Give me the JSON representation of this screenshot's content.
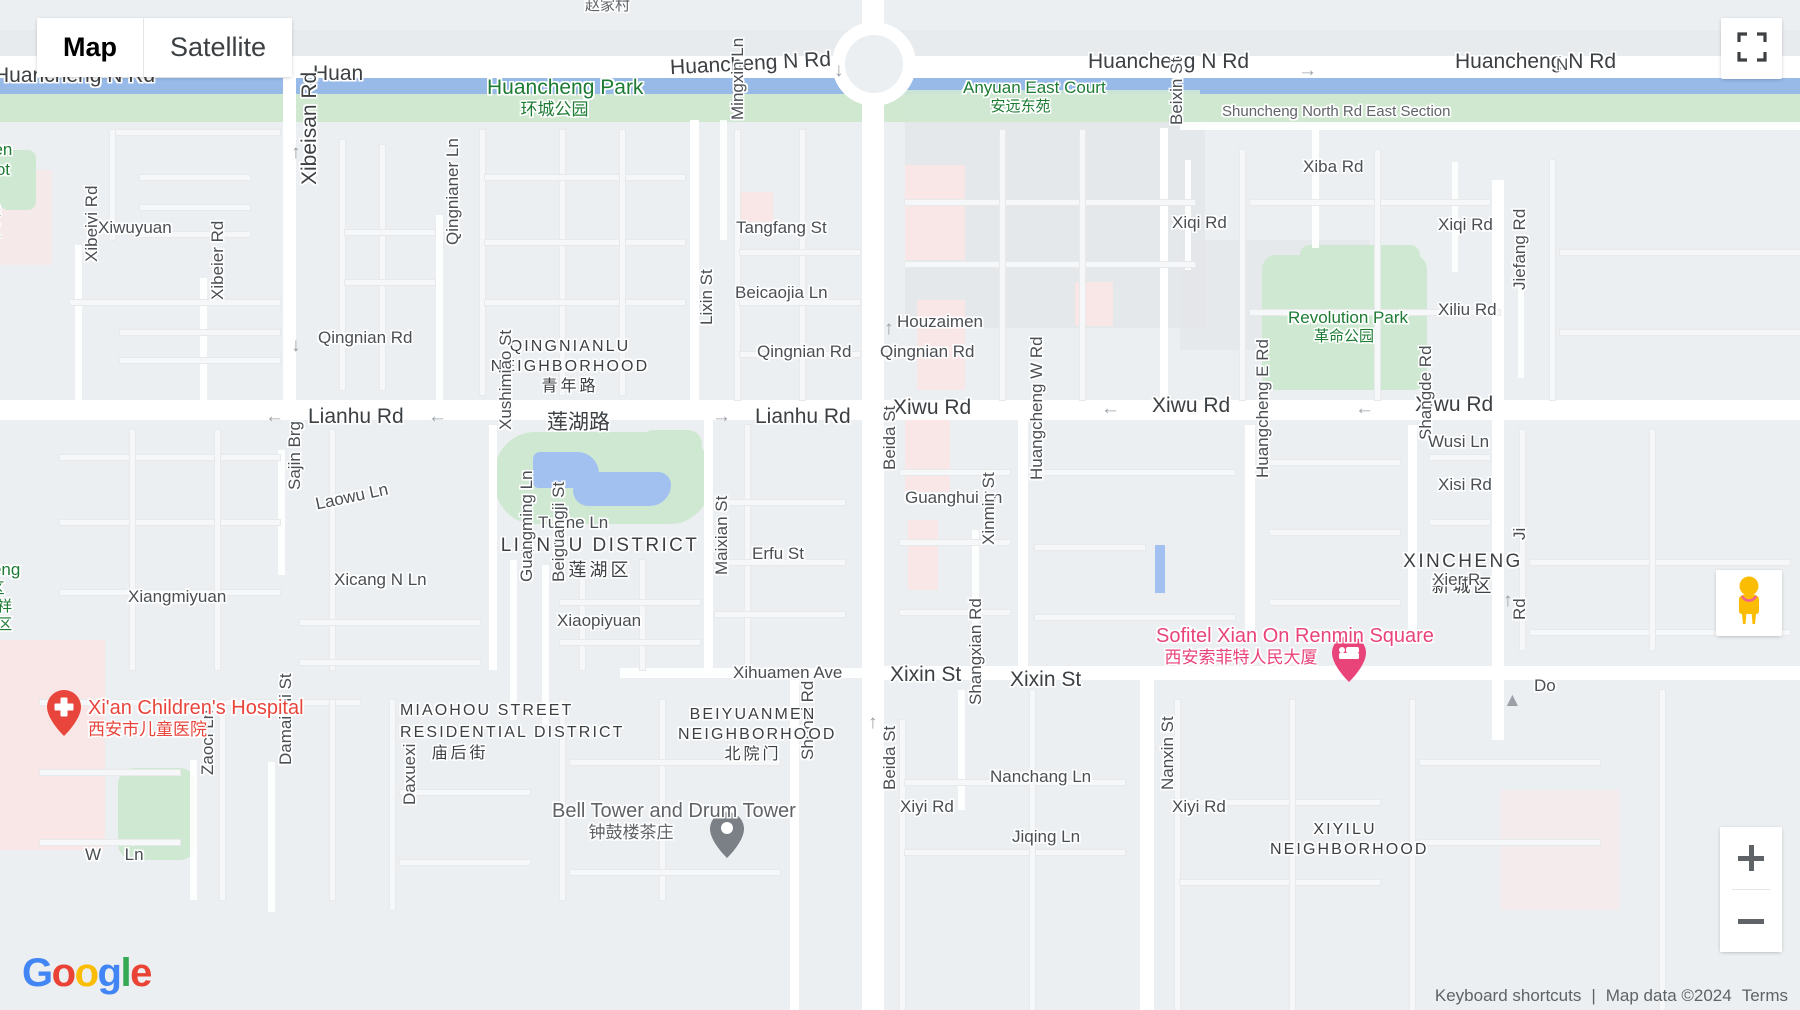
{
  "controls": {
    "map_type": {
      "map_label": "Map",
      "satellite_label": "Satellite",
      "active": "Map"
    },
    "fullscreen_label": "Toggle fullscreen view",
    "pegman_label": "Drag Pegman onto the map to open Street View",
    "zoom_in_label": "Zoom in",
    "zoom_out_label": "Zoom out"
  },
  "attribution": {
    "keyboard_shortcuts": "Keyboard shortcuts",
    "map_data": "Map data ©2024",
    "terms": "Terms",
    "logo": "Google"
  },
  "pois": [
    {
      "name_en": "Xi'an Children's Hospital",
      "name_cn": "西安市儿童医院",
      "type": "hospital",
      "color": "#e8453c"
    },
    {
      "name_en": "Sofitel Xian On Renmin Square",
      "name_cn": "西安索菲特人民大厦",
      "type": "hotel",
      "color": "#e8447a"
    },
    {
      "name_en": "Bell Tower and Drum Tower",
      "name_cn": "钟鼓楼茶庄",
      "type": "attraction",
      "color": "#5f6368"
    }
  ],
  "parks": [
    {
      "name_en": "Huancheng Park",
      "name_cn": "环城公园",
      "color": "#1e7b34"
    },
    {
      "name_en": "Revolution Park",
      "name_cn": "革命公园",
      "color": "#1e7b34"
    },
    {
      "name_en": "Anyuan East Court",
      "name_cn": "安远东苑",
      "color": "#1e7b34"
    },
    {
      "name_en": "Yuxiang",
      "name_cn": "玉祥",
      "color": "#1e7b34"
    }
  ],
  "neighborhoods": [
    {
      "name_en_1": "QINGNIANLU",
      "name_en_2": "NEIGHBORHOOD",
      "name_cn": "青年路"
    },
    {
      "name_en_1": "BEIYUANMEN",
      "name_en_2": "NEIGHBORHOOD",
      "name_cn": "北院门"
    },
    {
      "name_en_1": "XIYILU",
      "name_en_2": "NEIGHBORHOOD",
      "name_cn": ""
    },
    {
      "name_en_1": "MIAOHOU STREET",
      "name_en_2": "RESIDENTIAL DISTRICT",
      "name_cn": "庙后街"
    }
  ],
  "districts": [
    {
      "name_en": "LIANHU DISTRICT",
      "name_cn": "莲湖区"
    },
    {
      "name_en": "XINCHENG",
      "name_cn": "新城区"
    }
  ],
  "streets": {
    "huancheng_n_rd_1": "Huancheng N Rd",
    "huancheng_n_rd_2": "Huancheng N Rd",
    "huancheng_n_rd_3": "Huancheng N Rd",
    "huancheng_n_rd_4": "Huancheng N Rd",
    "huancheng_n_rd_5": "Huan",
    "shuncheng_north": "Shuncheng North Rd East Section",
    "zhaojiacun": "赵家村",
    "xibeisan_rd": "Xibeisan Rd",
    "xibeiyi_rd": "Xibeiyi Rd",
    "xibeier_rd": "Xibeier Rd",
    "xiwuyuan": "Xiwuyuan",
    "qingnianer_ln": "Qingnianer Ln",
    "qingnian_rd_1": "Qingnian Rd",
    "qingnian_rd_2": "Qingnian Rd",
    "qingnian_rd_3": "Qingnian Rd",
    "mingxin_ln": "Mingxin Ln",
    "tangfang_st": "Tangfang St",
    "beicaojia_ln": "Beicaojia Ln",
    "lixin_st": "Lixin St",
    "houzaimen": "Houzaimen",
    "beixin_st": "Beixin St",
    "xiba_rd": "Xiba Rd",
    "xiqi_rd_1": "Xiqi Rd",
    "xiqi_rd_2": "Xiqi Rd",
    "xiliu_rd": "Xiliu Rd",
    "jiefang_rd": "Jiefang Rd",
    "lianhu_rd_1": "Lianhu Rd",
    "lianhu_rd_cn": "莲湖路",
    "lianhu_rd_2": "Lianhu Rd",
    "xiwu_rd_1": "Xiwu Rd",
    "xiwu_rd_2": "Xiwu Rd",
    "xiwu_rd_3": "Xiwu Rd",
    "wusi_ln": "Wusi Ln",
    "xisi_rd": "Xisi Rd",
    "shangde_rd": "Shangde Rd",
    "beida_st_1": "Beida St",
    "beida_st_2": "Beida St",
    "guanghui_ln": "Guanghui Ln",
    "xinmin_st": "Xinmin St",
    "huangcheng_w_rd": "Huangcheng W Rd",
    "huangcheng_e_rd": "Huangcheng E Rd",
    "sajin_brg": "Sajin Brg",
    "laowu_ln": "Laowu Ln",
    "xushimiao_st": "Xushimiao St",
    "tuche_ln": "Tuche Ln",
    "erfu_st": "Erfu St",
    "xicang_n_ln": "Xicang N Ln",
    "xiangmiyuan": "Xiangmiyuan",
    "guangming_ln": "Guangming Ln",
    "beiguangji_st": "Beiguangji St",
    "xiaopiyuan": "Xiaopiyuan",
    "maixian_st": "Maixian St",
    "xihuamen_ave": "Xihuamen Ave",
    "xixin_st_1": "Xixin St",
    "xixin_st_2": "Xixin St",
    "shehui_rd": "Shehui Rd",
    "shangxian_rd": "Shangxian Rd",
    "nanchang_ln": "Nanchang Ln",
    "xiyi_rd_1": "Xiyi Rd",
    "xiyi_rd_2": "Xiyi Rd",
    "jiqing_ln": "Jiqing Ln",
    "nanxin_st": "Nanxin St",
    "daxuexi": "Daxuexi",
    "damaishi_st": "Damaishi St",
    "zaoci_ln": "Zaoci Ln",
    "w_ln": "W ... Ln",
    "xier_rd": "Xier R",
    "do_partial": "Do",
    "ji_partial": "Ji"
  },
  "colors": {
    "land": "#eceff1",
    "road": "#ffffff",
    "park_green": "#cfe8d2",
    "water_blue": "#a3c1f0",
    "label_grey": "#5f6368",
    "poi_red": "#e8453c",
    "poi_pink": "#e8447a"
  }
}
